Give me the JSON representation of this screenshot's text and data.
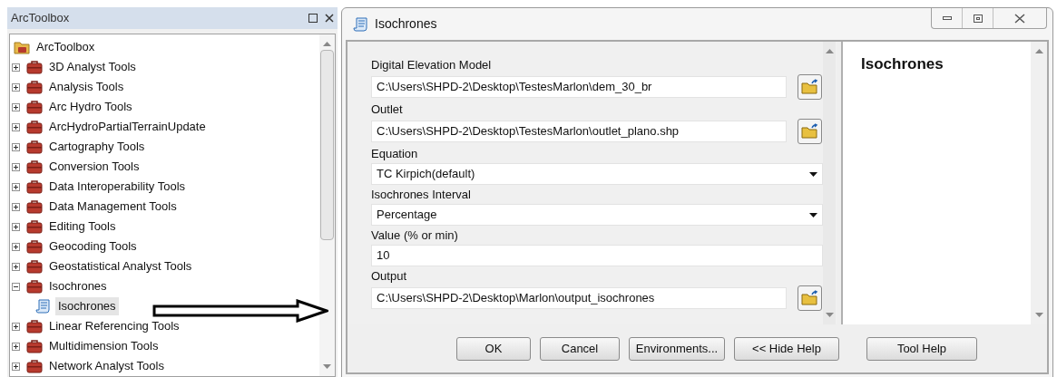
{
  "toolbox": {
    "title": "ArcToolbox",
    "tree": {
      "label": "ArcToolbox",
      "kind": "root",
      "children": [
        {
          "label": "3D Analyst Tools",
          "kind": "toolbox",
          "expanded": false
        },
        {
          "label": "Analysis Tools",
          "kind": "toolbox",
          "expanded": false
        },
        {
          "label": "Arc Hydro Tools",
          "kind": "toolbox",
          "expanded": false
        },
        {
          "label": "ArcHydroPartialTerrainUpdate",
          "kind": "toolbox",
          "expanded": false
        },
        {
          "label": "Cartography Tools",
          "kind": "toolbox",
          "expanded": false
        },
        {
          "label": "Conversion Tools",
          "kind": "toolbox",
          "expanded": false
        },
        {
          "label": "Data Interoperability Tools",
          "kind": "toolbox",
          "expanded": false
        },
        {
          "label": "Data Management Tools",
          "kind": "toolbox",
          "expanded": false
        },
        {
          "label": "Editing Tools",
          "kind": "toolbox",
          "expanded": false
        },
        {
          "label": "Geocoding Tools",
          "kind": "toolbox",
          "expanded": false
        },
        {
          "label": "Geostatistical Analyst Tools",
          "kind": "toolbox",
          "expanded": false
        },
        {
          "label": "Isochrones",
          "kind": "toolbox",
          "expanded": true,
          "children": [
            {
              "label": "Isochrones",
              "kind": "tool",
              "selected": true
            }
          ]
        },
        {
          "label": "Linear Referencing Tools",
          "kind": "toolbox",
          "expanded": false
        },
        {
          "label": "Multidimension Tools",
          "kind": "toolbox",
          "expanded": false
        },
        {
          "label": "Network Analyst Tools",
          "kind": "toolbox",
          "expanded": false
        }
      ]
    }
  },
  "dialog": {
    "title": "Isochrones",
    "fields": [
      {
        "label": "Digital Elevation Model",
        "value": "C:\\Users\\SHPD-2\\Desktop\\TestesMarlon\\dem_30_br",
        "kind": "path"
      },
      {
        "label": "Outlet",
        "value": "C:\\Users\\SHPD-2\\Desktop\\TestesMarlon\\outlet_plano.shp",
        "kind": "path"
      },
      {
        "label": "Equation",
        "value": "TC Kirpich(default)",
        "kind": "dropdown"
      },
      {
        "label": "Isochrones Interval",
        "value": "Percentage",
        "kind": "dropdown"
      },
      {
        "label": "Value (% or min)",
        "value": "10",
        "kind": "text"
      },
      {
        "label": "Output",
        "value": "C:\\Users\\SHPD-2\\Desktop\\Marlon\\output_isochrones",
        "kind": "path"
      }
    ],
    "help_title": "Isochrones",
    "buttons": [
      "OK",
      "Cancel",
      "Environments...",
      "<< Hide Help"
    ],
    "help_button": "Tool Help"
  }
}
